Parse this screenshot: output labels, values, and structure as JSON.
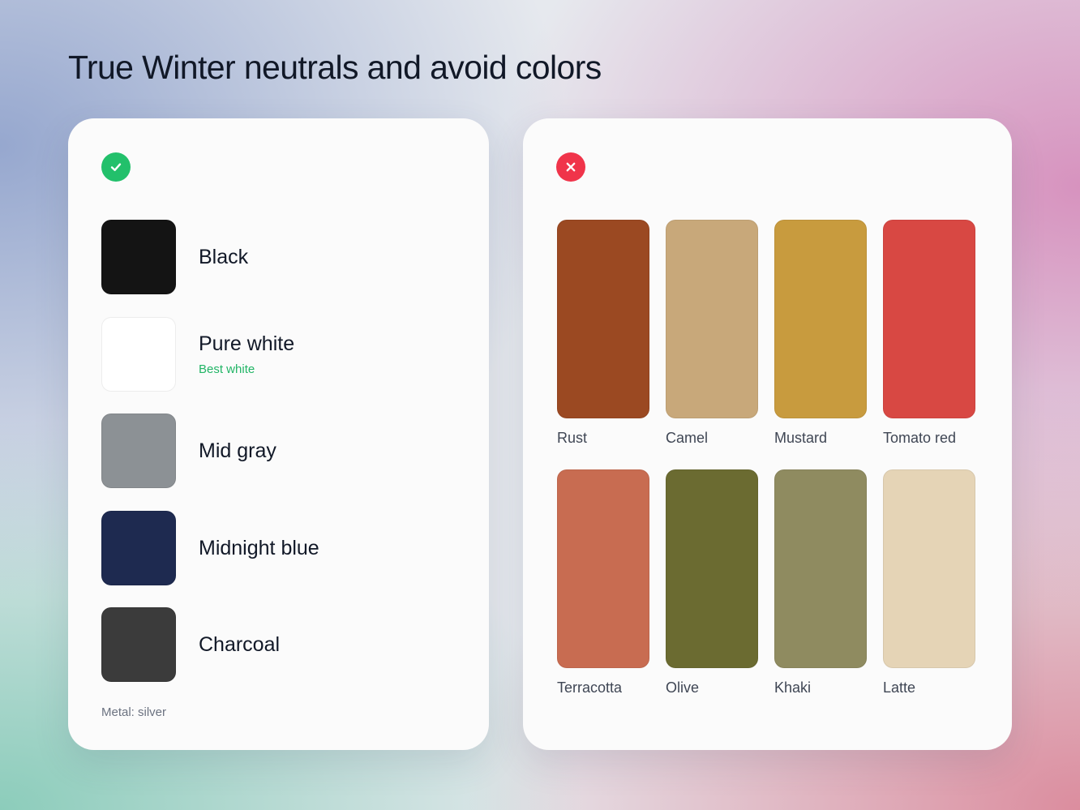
{
  "title": "True Winter neutrals and avoid colors",
  "good_panel": {
    "icon": "check-circle-icon",
    "icon_color": "#22c06b",
    "items": [
      {
        "name": "Black",
        "note": "",
        "color": "#141414"
      },
      {
        "name": "Pure white",
        "note": "Best white",
        "color": "#ffffff"
      },
      {
        "name": "Mid gray",
        "note": "",
        "color": "#8c9195"
      },
      {
        "name": "Midnight blue",
        "note": "",
        "color": "#1e2a50"
      },
      {
        "name": "Charcoal",
        "note": "",
        "color": "#3b3b3b"
      }
    ],
    "metal": "Metal: silver"
  },
  "avoid_panel": {
    "icon": "x-circle-icon",
    "icon_color": "#f0344a",
    "items": [
      {
        "name": "Rust",
        "color": "#9b4922"
      },
      {
        "name": "Camel",
        "color": "#c8a87a"
      },
      {
        "name": "Mustard",
        "color": "#c89b3e"
      },
      {
        "name": "Tomato red",
        "color": "#d84843"
      },
      {
        "name": "Terracotta",
        "color": "#c86c51"
      },
      {
        "name": "Olive",
        "color": "#6b6b31"
      },
      {
        "name": "Khaki",
        "color": "#8f8b60"
      },
      {
        "name": "Latte",
        "color": "#e5d4b6"
      }
    ]
  }
}
